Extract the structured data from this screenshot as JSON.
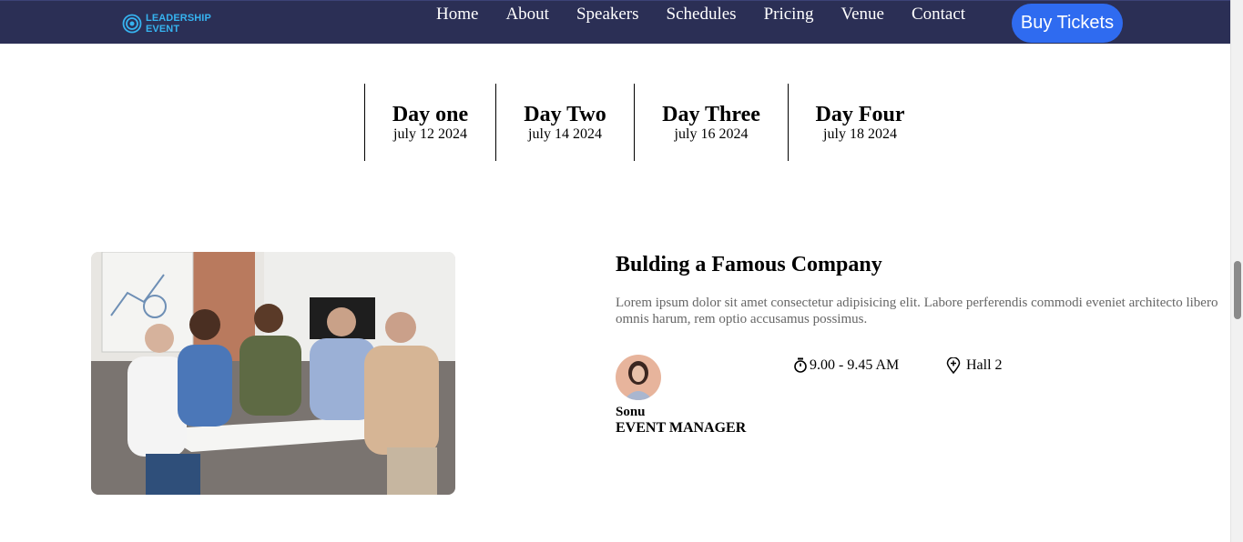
{
  "nav": {
    "logo_line1": "LEADERSHIP",
    "logo_line2": "EVENT",
    "links": [
      "Home",
      "About",
      "Speakers",
      "Schedules",
      "Pricing",
      "Venue",
      "Contact"
    ],
    "buy_label": "Buy Tickets"
  },
  "days": [
    {
      "title": "Day one",
      "date": "july 12 2024"
    },
    {
      "title": "Day Two",
      "date": "july 14 2024"
    },
    {
      "title": "Day Three",
      "date": "july 16 2024"
    },
    {
      "title": "Day Four",
      "date": "july 18 2024"
    }
  ],
  "session": {
    "title": "Bulding a Famous Company",
    "description": "Lorem ipsum dolor sit amet consectetur adipisicing elit. Labore perferendis commodi eveniet architecto libero omnis harum, rem optio accusamus possimus.",
    "speaker_name": "Sonu",
    "speaker_role": "EVENT MANAGER",
    "time": "9.00 - 9.45 AM",
    "venue": "Hall 2"
  },
  "colors": {
    "navbar": "#2b2f55",
    "logo": "#36b3f0",
    "button": "#2f6bf0",
    "description": "#666666"
  }
}
